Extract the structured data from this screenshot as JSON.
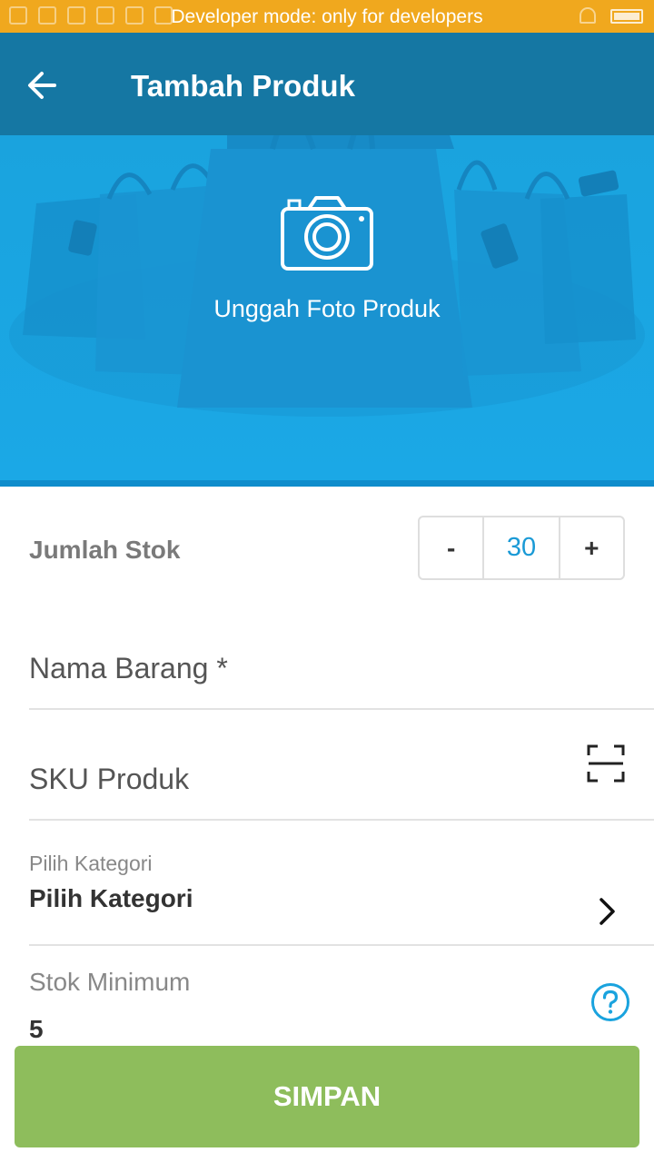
{
  "status_bar": {
    "message": "Developer mode: only for developers",
    "color": "#f0a81e"
  },
  "header": {
    "title": "Tambah Produk",
    "back_icon": "arrow-left-icon",
    "color": "#1577a3"
  },
  "hero": {
    "upload_label": "Unggah Foto Produk",
    "camera_icon": "camera-icon",
    "color": "#1aa3de"
  },
  "stock": {
    "label": "Jumlah Stok",
    "decrement_label": "-",
    "value": "30",
    "increment_label": "+"
  },
  "form": {
    "name_placeholder": "Nama Barang *",
    "sku_placeholder": "SKU Produk",
    "scan_icon": "barcode-scan-icon",
    "category_label": "Pilih Kategori",
    "category_value": "Pilih Kategori",
    "min_stock_label": "Stok Minimum",
    "min_stock_value": "5",
    "help_icon": "question-mark-icon"
  },
  "actions": {
    "save_label": "SIMPAN",
    "save_color": "#8ebd5c"
  }
}
